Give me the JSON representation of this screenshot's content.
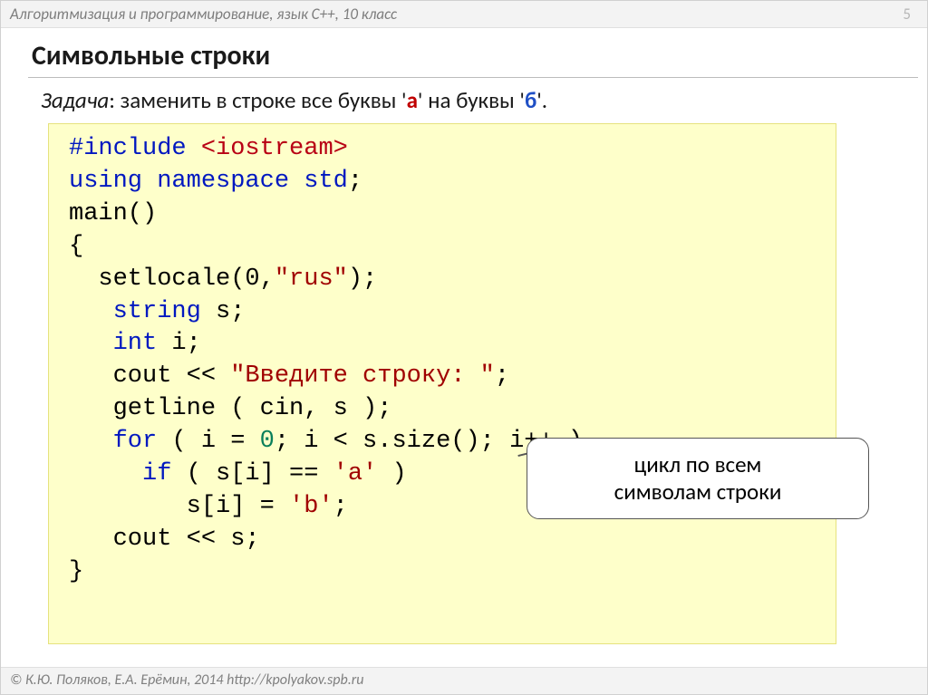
{
  "header": {
    "course": "Алгоритмизация и программирование, язык С++, 10 класс",
    "page_number": "5"
  },
  "title": "Символьные строки",
  "task": {
    "lead": "Задача",
    "text": ": заменить в строке все буквы '",
    "a": "а",
    "mid": "' на буквы '",
    "b": "б",
    "tail": "'."
  },
  "code": {
    "l1_a": "#include ",
    "l1_b": "<iostream>",
    "l2_a": "using",
    "l2_b": " namespace ",
    "l2_c": "std",
    "l2_d": ";",
    "l3": "main()",
    "l4": "{",
    "l5_a": "  setlocale(0,",
    "l5_b": "\"rus\"",
    "l5_c": ");",
    "l6_a": "   ",
    "l6_b": "string",
    "l6_c": " s;",
    "l7_a": "   ",
    "l7_b": "int",
    "l7_c": " i;",
    "l8_a": "   cout << ",
    "l8_b": "\"Введите строку: \"",
    "l8_c": ";",
    "l9": "   getline ( cin, s );",
    "l10_a": "   ",
    "l10_b": "for",
    "l10_c": " ( i = ",
    "l10_d": "0",
    "l10_e": "; i < s.size(); i++ )",
    "l11_a": "     ",
    "l11_b": "if",
    "l11_c": " ( s[i] == ",
    "l11_d": "'a'",
    "l11_e": " )",
    "l12_a": "        s[i] = ",
    "l12_b": "'b'",
    "l12_c": ";",
    "l13": "   cout << s;",
    "l14": "}"
  },
  "callout": "цикл по всем\nсимволам строки",
  "footer": "© К.Ю. Поляков, Е.А. Ерёмин, 2014   http://kpolyakov.spb.ru"
}
